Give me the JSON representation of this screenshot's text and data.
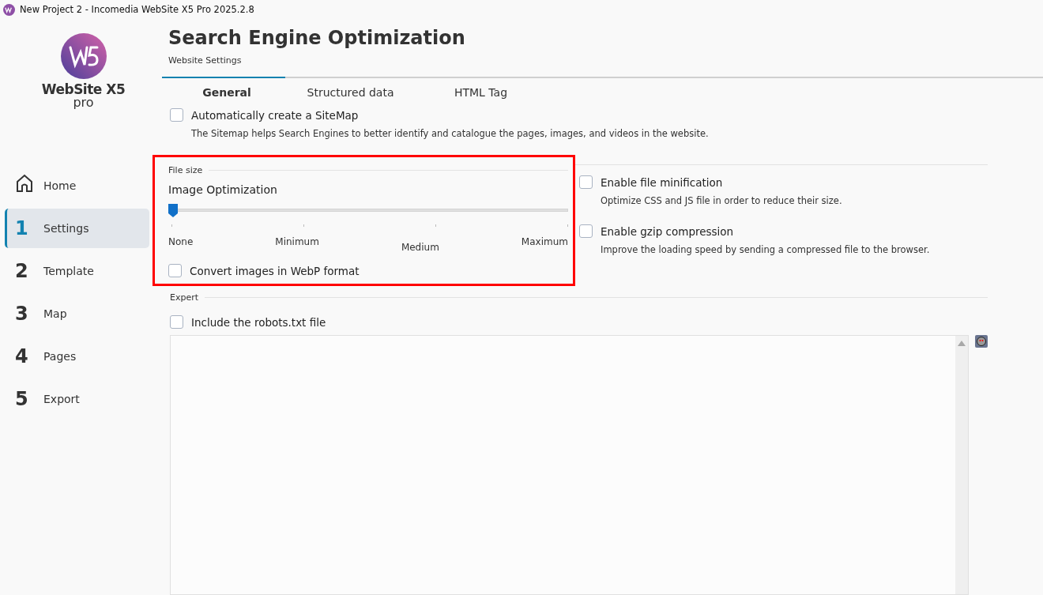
{
  "window": {
    "title": "New Project 2 - Incomedia WebSite X5 Pro 2025.2.8"
  },
  "logo": {
    "name": "WebSite X5",
    "edition": "pro"
  },
  "sidebar": {
    "items": [
      {
        "kind": "home",
        "label": "Home",
        "selected": false
      },
      {
        "kind": "step",
        "number": "1",
        "label": "Settings",
        "selected": true
      },
      {
        "kind": "step",
        "number": "2",
        "label": "Template",
        "selected": false
      },
      {
        "kind": "step",
        "number": "3",
        "label": "Map",
        "selected": false
      },
      {
        "kind": "step",
        "number": "4",
        "label": "Pages",
        "selected": false
      },
      {
        "kind": "step",
        "number": "5",
        "label": "Export",
        "selected": false
      }
    ]
  },
  "header": {
    "title": "Search Engine Optimization",
    "subtitle": "Website Settings"
  },
  "tabs": [
    {
      "label": "General",
      "selected": true
    },
    {
      "label": "Structured data",
      "selected": false
    },
    {
      "label": "HTML Tag",
      "selected": false
    }
  ],
  "sitemap": {
    "label": "Automatically create a SiteMap",
    "checked": false,
    "description": "The Sitemap helps Search Engines to better identify and catalogue the pages, images, and videos in the website."
  },
  "file_size": {
    "title": "File size",
    "highlighted": true,
    "image_optimization": {
      "label": "Image Optimization",
      "level": 0,
      "ticks": [
        "None",
        "Minimum",
        "Medium",
        "Maximum"
      ]
    },
    "webp": {
      "label": "Convert images in WebP format",
      "checked": false
    },
    "options": [
      {
        "label": "Enable file minification",
        "checked": false,
        "description": "Optimize CSS and JS file in order to reduce their size."
      },
      {
        "label": "Enable gzip compression",
        "checked": false,
        "description": "Improve the loading speed by sending a compressed file to the browser."
      }
    ]
  },
  "expert": {
    "title": "Expert",
    "robots": {
      "label": "Include the robots.txt file",
      "checked": false
    }
  }
}
